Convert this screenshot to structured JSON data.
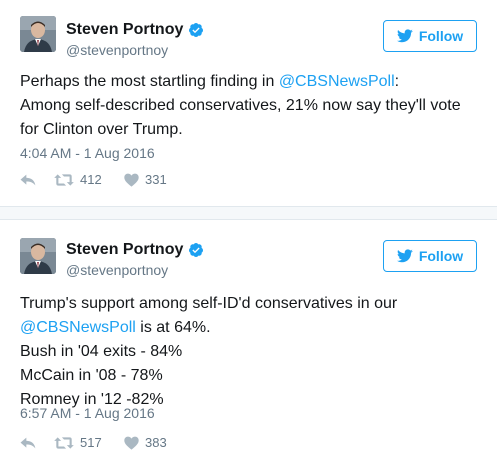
{
  "tweets": [
    {
      "author_name": "Steven Portnoy",
      "handle": "@stevenportnoy",
      "follow_label": "Follow",
      "text_lines": [
        {
          "before": "Perhaps the most startling finding in ",
          "mention": "@CBSNewsPoll",
          "after": ":"
        },
        {
          "before": "Among self-described conservatives, 21% now say they'll vote",
          "mention": "",
          "after": ""
        },
        {
          "before": "for Clinton over Trump.",
          "mention": "",
          "after": ""
        }
      ],
      "timestamp": "4:04 AM - 1 Aug 2016",
      "retweets": "412",
      "likes": "331"
    },
    {
      "author_name": "Steven Portnoy",
      "handle": "@stevenportnoy",
      "follow_label": "Follow",
      "text_lines": [
        {
          "before": "Trump's support among self-ID'd conservatives in our",
          "mention": "",
          "after": ""
        },
        {
          "before": "",
          "mention": "@CBSNewsPoll",
          "after": " is at 64%."
        },
        {
          "before": "Bush in '04 exits - 84%",
          "mention": "",
          "after": ""
        },
        {
          "before": "McCain in '08 - 78%",
          "mention": "",
          "after": ""
        },
        {
          "before": "Romney in '12 -82%",
          "mention": "",
          "after": ""
        }
      ],
      "timestamp": "6:57 AM - 1 Aug 2016",
      "retweets": "517",
      "likes": "383"
    }
  ],
  "colors": {
    "accent": "#1da1f2",
    "muted": "#657786",
    "icon": "#aab8c2",
    "separator": "#f5f8fa"
  },
  "icons": [
    "verified-badge-icon",
    "twitter-bird-icon",
    "reply-icon",
    "retweet-icon",
    "like-heart-icon"
  ]
}
